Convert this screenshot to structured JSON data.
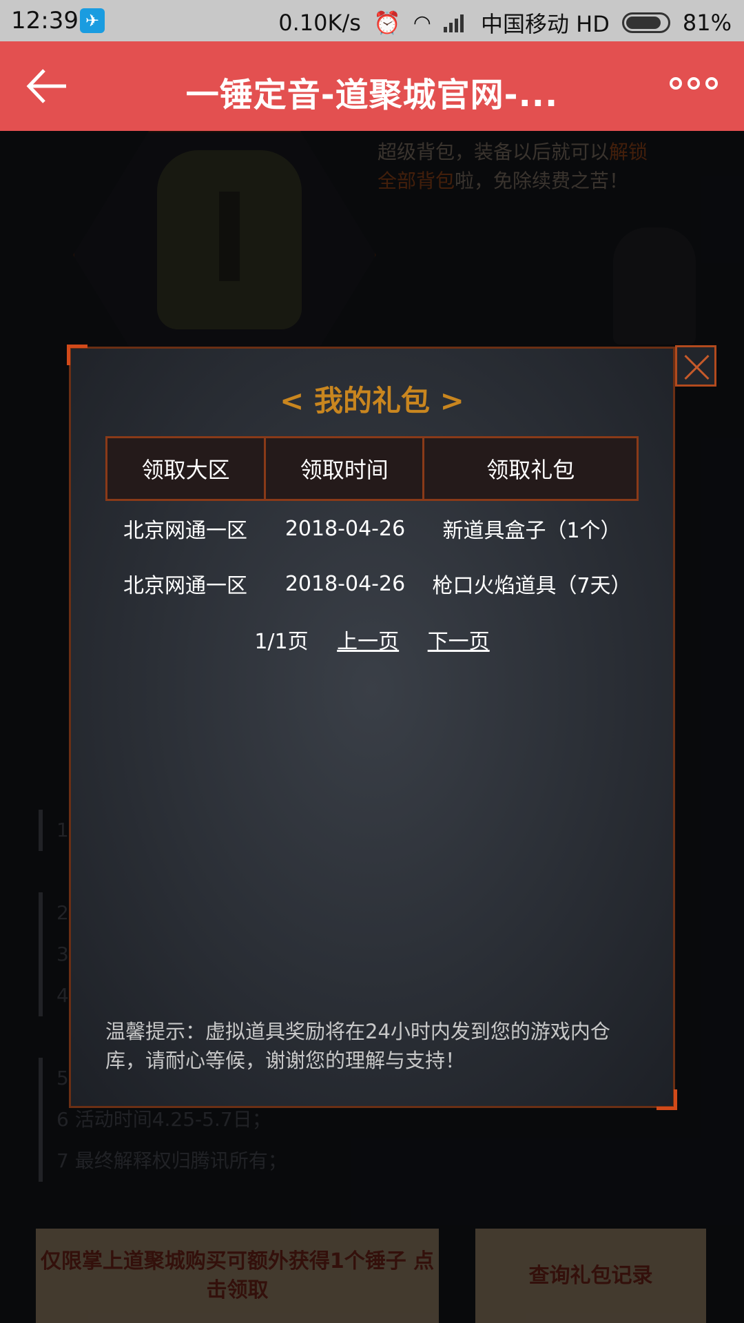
{
  "status_bar": {
    "time": "12:39",
    "network_speed": "0.10K/s",
    "carrier": "中国移动 HD",
    "battery": "81%"
  },
  "header": {
    "title": "一锤定音-道聚城官网-..."
  },
  "background": {
    "promo_line1": "超级背包，装备以后就可以",
    "promo_hl1": "解锁",
    "promo_hl2": "全部背包",
    "promo_line2": "啦，免除续费之苦！",
    "rule_items": [
      "1",
      "2",
      "3",
      "4",
      "5",
      "6 活动时间4.25-5.7日；",
      "7 最终解释权归腾讯所有；"
    ],
    "bottom_left_button": "仅限掌上道聚城购买可额外获得1个锤子 点击领取",
    "bottom_right_button": "查询礼包记录"
  },
  "modal": {
    "title": "< 我的礼包 >",
    "columns": [
      "领取大区",
      "领取时间",
      "领取礼包"
    ],
    "rows": [
      [
        "北京网通一区",
        "2018-04-26",
        "新道具盒子（1个）"
      ],
      [
        "北京网通一区",
        "2018-04-26",
        "枪口火焰道具（7天）"
      ]
    ],
    "pager": {
      "page_info": "1/1页",
      "prev": "上一页",
      "next": "下一页"
    },
    "tip": "温馨提示：虚拟道具奖励将在24小时内发到您的游戏内仓库，请耐心等候，谢谢您的理解与支持！"
  }
}
